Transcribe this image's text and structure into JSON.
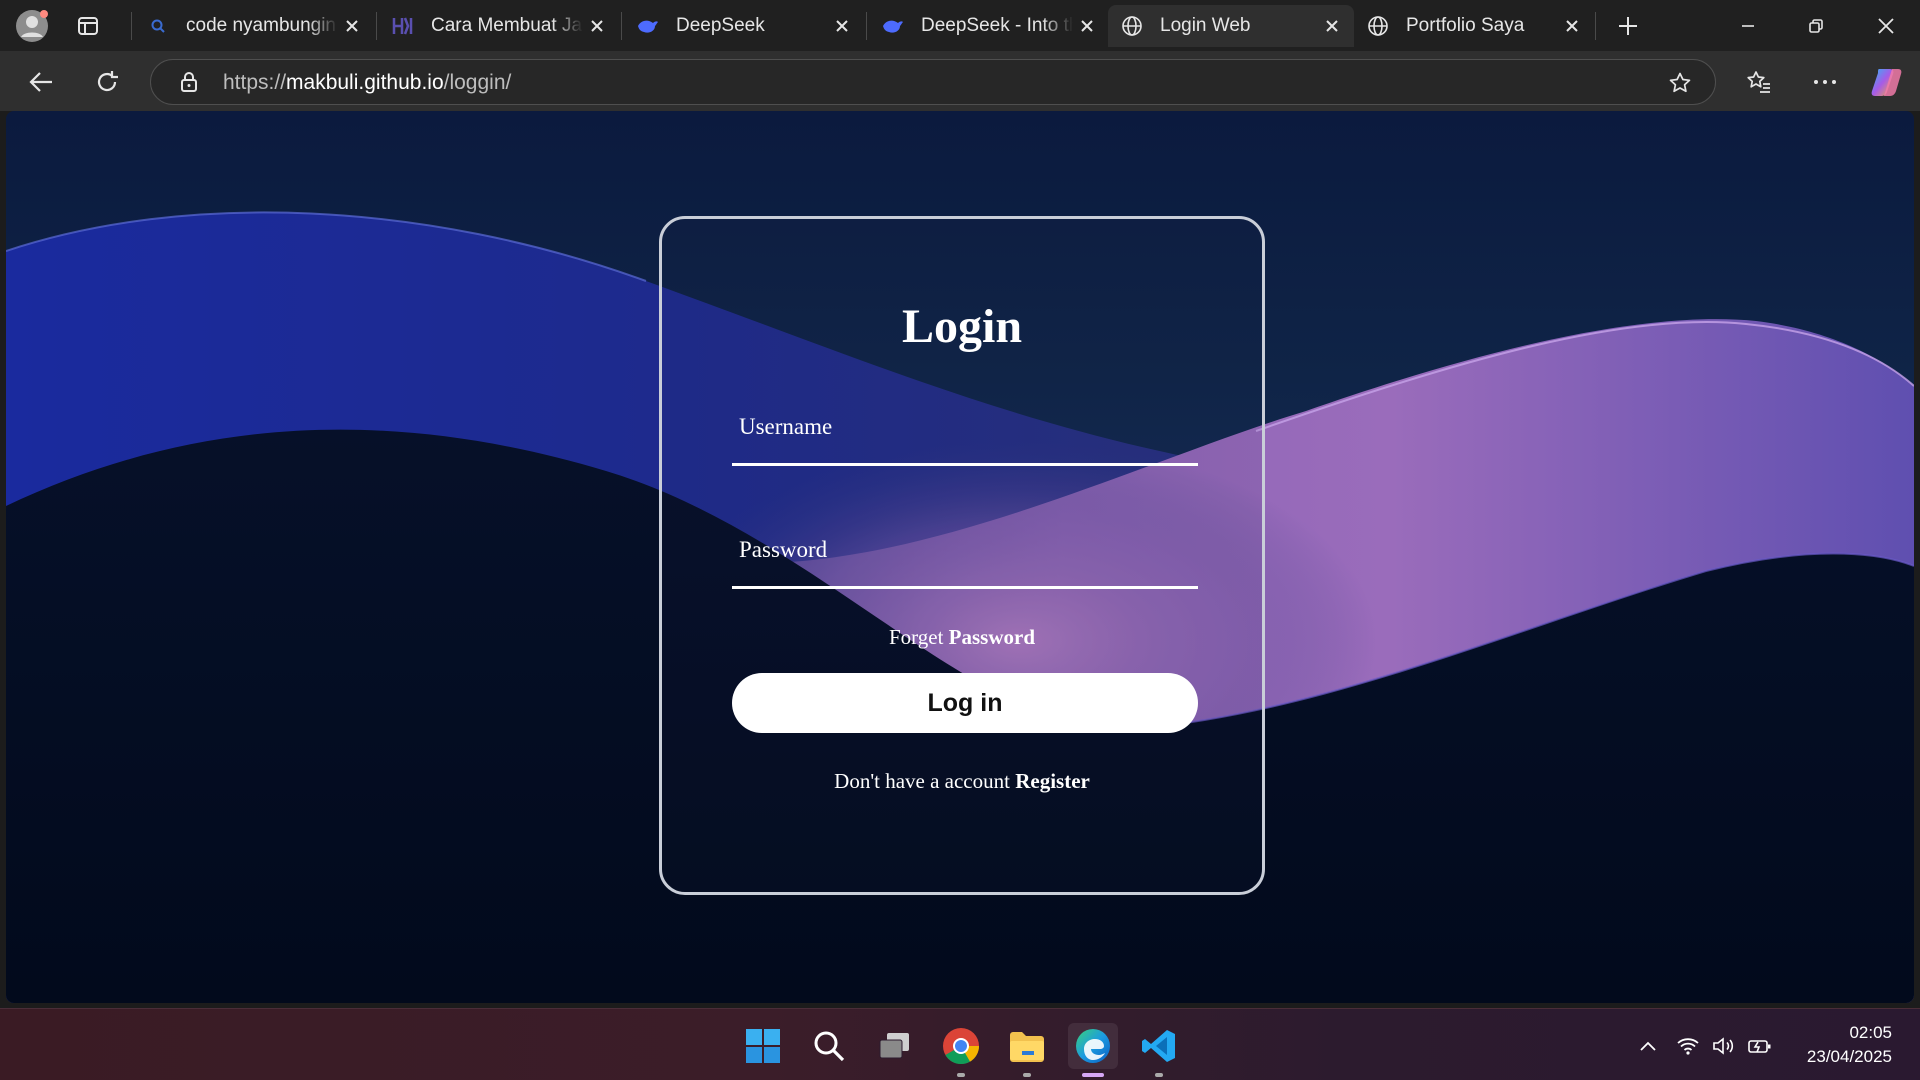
{
  "browser": {
    "tabs": [
      {
        "title": "code nyambungin j",
        "icon": "search-favicon",
        "active": false
      },
      {
        "title": "Cara Membuat Java",
        "icon": "site-favicon",
        "active": false
      },
      {
        "title": "DeepSeek",
        "icon": "deepseek-favicon",
        "active": false
      },
      {
        "title": "DeepSeek - Into the",
        "icon": "deepseek-favicon",
        "active": false
      },
      {
        "title": "Login Web",
        "icon": "globe-icon",
        "active": true
      },
      {
        "title": "Portfolio Saya",
        "icon": "globe-icon",
        "active": false
      }
    ],
    "address": {
      "scheme": "https://",
      "host": "makbuli.github.io",
      "path": "/loggin/"
    }
  },
  "login": {
    "title": "Login",
    "username_label": "Username",
    "password_label": "Password",
    "forget_prefix": "Forget",
    "forget_bold": "Password",
    "login_button": "Log in",
    "register_prefix": "Don't have a account",
    "register_bold": "Register"
  },
  "taskbar": {
    "apps": [
      "windows-start",
      "search",
      "task-view",
      "chrome",
      "file-explorer",
      "edge",
      "vscode"
    ],
    "time": "02:05",
    "date": "23/04/2025"
  },
  "colors": {
    "accent": "#d6a7f5",
    "page_bg": "#0f2447",
    "wave_blue": "#1d2a9a",
    "wave_purple": "#8a5bb8"
  }
}
